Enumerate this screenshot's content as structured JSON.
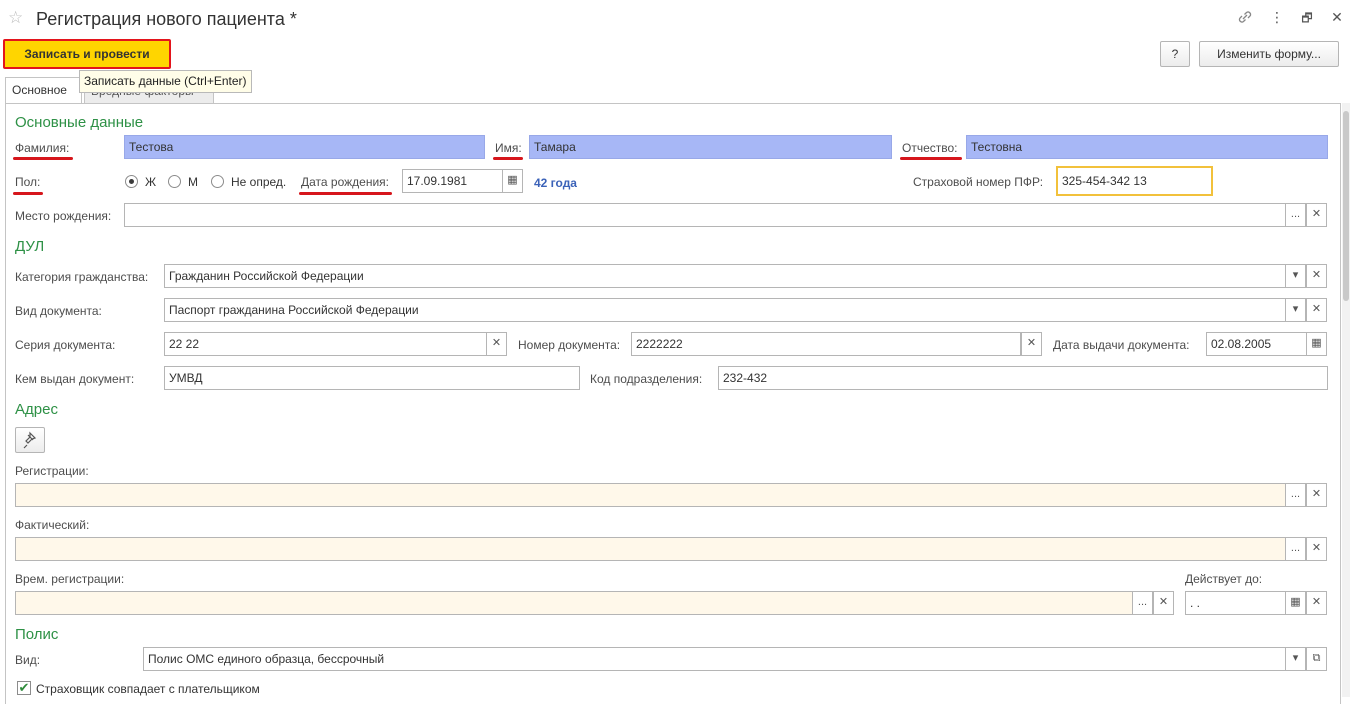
{
  "window": {
    "title": "Регистрация нового пациента *",
    "star_icon": "star-icon",
    "link_icon": "link-icon",
    "more_icon": "more-vertical-icon",
    "restore_icon": "restore-window-icon",
    "close_icon": "close-icon"
  },
  "toolbar": {
    "save_post_label": "Записать и провести",
    "tooltip": "Записать данные (Ctrl+Enter)",
    "help_label": "?",
    "change_form_label": "Изменить форму..."
  },
  "tabs": [
    {
      "label": "Основное",
      "active": true
    },
    {
      "label": "Вредные факторы",
      "active": false
    }
  ],
  "main": {
    "section_title": "Основные данные",
    "surname_label": "Фамилия:",
    "surname_value": "Тестова",
    "name_label": "Имя:",
    "name_value": "Тамара",
    "patronymic_label": "Отчество:",
    "patronymic_value": "Тестовна",
    "gender_label": "Пол:",
    "gender_options": [
      "Ж",
      "М",
      "Не опред."
    ],
    "gender_selected": "Ж",
    "birthdate_label": "Дата рождения:",
    "birthdate_value": "17.09.1981",
    "age_text": "42 года",
    "snils_label": "Страховой номер ПФР:",
    "snils_value": "325-454-342 13",
    "birthplace_label": "Место рождения:",
    "birthplace_value": ""
  },
  "dul": {
    "section_title": "ДУЛ",
    "citizenship_label": "Категория гражданства:",
    "citizenship_value": "Гражданин Российской Федерации",
    "doctype_label": "Вид документа:",
    "doctype_value": "Паспорт гражданина Российской Федерации",
    "series_label": "Серия документа:",
    "series_value": "22 22",
    "number_label": "Номер документа:",
    "number_value": "2222222",
    "issue_date_label": "Дата выдачи документа:",
    "issue_date_value": "02.08.2005",
    "issued_by_label": "Кем выдан документ:",
    "issued_by_value": "УМВД",
    "dept_code_label": "Код подразделения:",
    "dept_code_value": "232-432"
  },
  "address": {
    "section_title": "Адрес",
    "pin_icon": "pin-icon",
    "registration_label": "Регистрации:",
    "registration_value": "",
    "actual_label": "Фактический:",
    "actual_value": "",
    "temp_label": "Врем. регистрации:",
    "temp_value": "",
    "valid_until_label": "Действует до:",
    "valid_until_value": " .  ."
  },
  "policy": {
    "section_title": "Полис",
    "type_label": "Вид:",
    "type_value": "Полис ОМС единого образца, бессрочный",
    "insurer_same_label": "Страховщик совпадает с плательщиком",
    "insurer_same_checked": true
  },
  "colors": {
    "highlight_red": "#d6161c",
    "primary_yellow": "#ffd500",
    "section_green": "#2e9146",
    "required_blue": "#a7b7f6"
  }
}
